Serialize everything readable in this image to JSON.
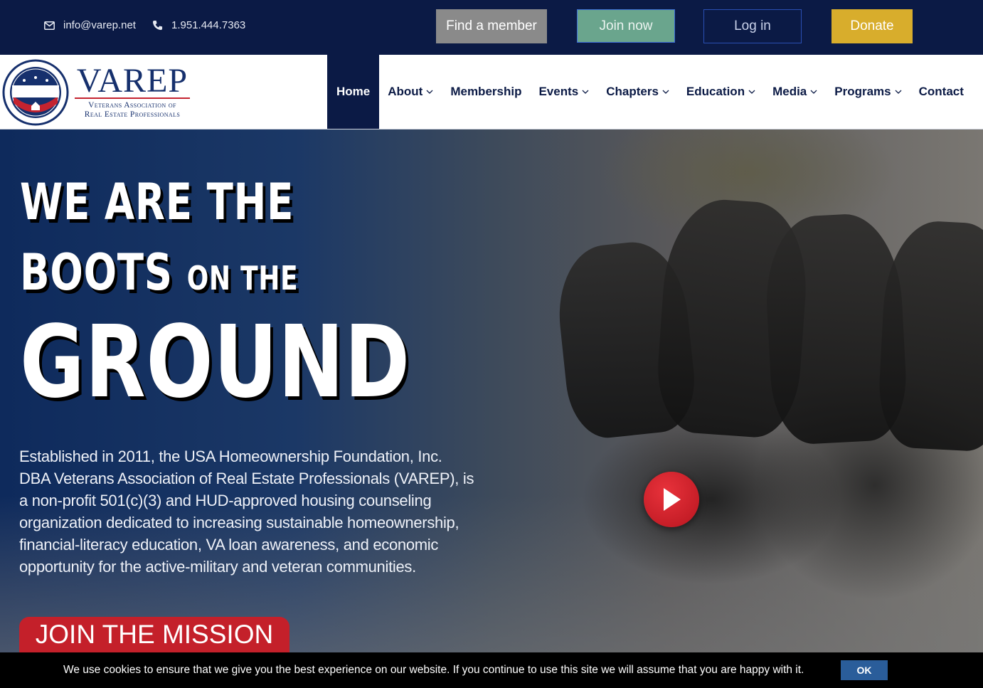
{
  "topbar": {
    "email": "info@varep.net",
    "phone": "1.951.444.7363",
    "find_member": "Find a member",
    "join_now": "Join now",
    "log_in": "Log in",
    "donate": "Donate"
  },
  "logo": {
    "name": "VAREP",
    "subtitle_line1": "Veterans Association of",
    "subtitle_line2": "Real Estate Professionals",
    "seal_text": "VAREP"
  },
  "nav": {
    "items": [
      {
        "label": "Home",
        "active": true,
        "dropdown": false
      },
      {
        "label": "About",
        "active": false,
        "dropdown": true
      },
      {
        "label": "Membership",
        "active": false,
        "dropdown": false
      },
      {
        "label": "Events",
        "active": false,
        "dropdown": true
      },
      {
        "label": "Chapters",
        "active": false,
        "dropdown": true
      },
      {
        "label": "Education",
        "active": false,
        "dropdown": true
      },
      {
        "label": "Media",
        "active": false,
        "dropdown": true
      },
      {
        "label": "Programs",
        "active": false,
        "dropdown": true
      },
      {
        "label": "Contact",
        "active": false,
        "dropdown": false
      }
    ]
  },
  "hero": {
    "line1": "WE ARE THE",
    "line2_big": "BOOTS",
    "line2_small": "ON THE",
    "line3": "GROUND",
    "intro": "Established in 2011, the USA Homeownership Foundation, Inc. DBA Veterans Association of Real Estate Professionals (VAREP), is a non-profit 501(c)(3) and HUD-approved housing counseling organization dedicated to increasing sustainable homeownership, financial-literacy education, VA loan awareness, and economic opportunity for the active-military and veteran communities.",
    "cta": "JOIN THE MISSION"
  },
  "cookie": {
    "text": "We use cookies to ensure that we give you the best experience on our website. If you continue to use this site we will assume that you are happy with it.",
    "ok": "OK"
  },
  "colors": {
    "navy": "#0b1a45",
    "donate": "#d8ad2c",
    "join": "#6aa58d",
    "cta_red": "#c4202a"
  }
}
